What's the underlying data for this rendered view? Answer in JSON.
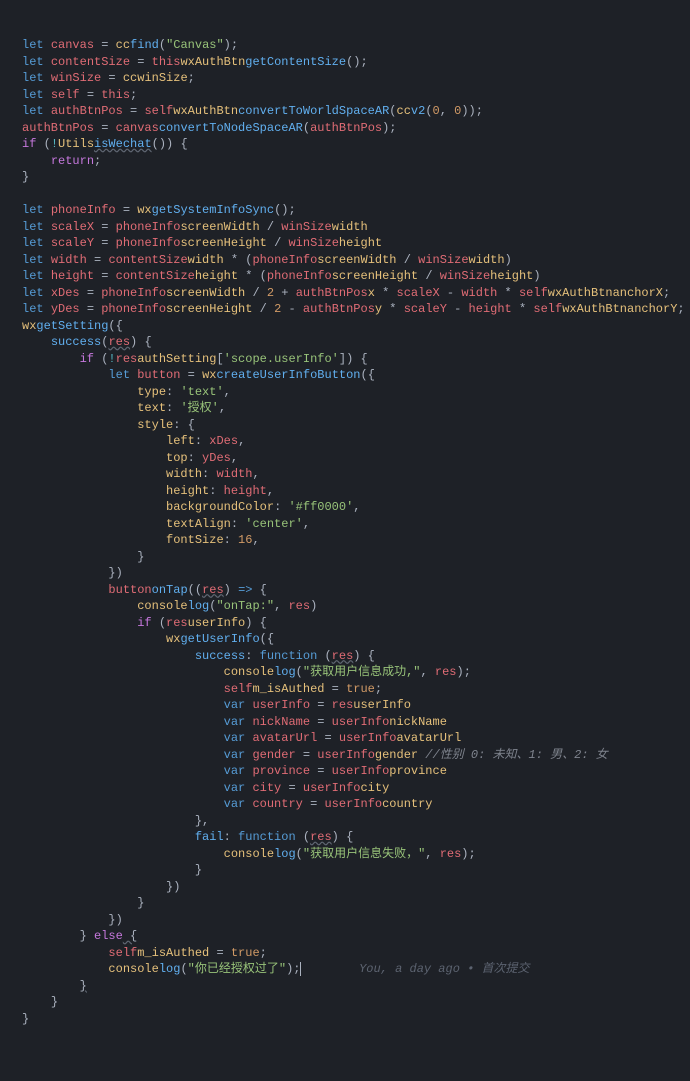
{
  "l1": {
    "let": "let",
    "canvas": "canvas",
    "eq": " = ",
    "cc": "cc",
    ".": ".",
    "find": "find",
    "p1": "(",
    "s": "\"Canvas\"",
    "p2": ");"
  },
  "l2": {
    "let": "let",
    "cs": "contentSize",
    "eq": " = ",
    "this": "this",
    ".": ".",
    "wx": "wxAuthBtn",
    ".2": ".",
    "gc": "getContentSize",
    "p": "();"
  },
  "l3": {
    "let": "let",
    "ws": "winSize",
    "eq": " = ",
    "cc": "cc",
    ".": ".",
    "wsz": "winSize",
    "sc": ";"
  },
  "l4": {
    "let": "let",
    "self": "self",
    "eq": " = ",
    "this": "this",
    "sc": ";"
  },
  "l5": {
    "let": "let",
    "abp": "authBtnPos",
    "eq": " = ",
    "self": "self",
    ".": ".",
    "wx": "wxAuthBtn",
    ".2": ".",
    "conv": "convertToWorldSpaceAR",
    "p1": "(",
    "cc": "cc",
    ".3": ".",
    "v2": "v2",
    "p2": "(",
    "z1": "0",
    "c": ", ",
    "z2": "0",
    "p3": "));"
  },
  "l6": {
    "abp": "authBtnPos",
    "eq": " = ",
    "canvas": "canvas",
    ".": ".",
    "conv": "convertToNodeSpaceAR",
    "p1": "(",
    "abp2": "authBtnPos",
    "p2": ");"
  },
  "l7": {
    "if": "if",
    "p1": " (",
    "neg": "!",
    "U": "Utils",
    ".": ".",
    "iw": "isWechat",
    "p2": "()) {"
  },
  "l8": {
    "ret": "return",
    "sc": ";"
  },
  "l9": {
    "b": "}"
  },
  "l11": {
    "let": "let",
    "pi": "phoneInfo",
    "eq": " = ",
    "wx": "wx",
    ".": ".",
    "gs": "getSystemInfoSync",
    "p": "();"
  },
  "l12": {
    "let": "let",
    "sx": "scaleX",
    "eq": " = ",
    "pi": "phoneInfo",
    ".": ".",
    "sw": "screenWidth",
    "d": " / ",
    "ws": "winSize",
    ".2": ".",
    "w": "width"
  },
  "l13": {
    "let": "let",
    "sy": "scaleY",
    "eq": " = ",
    "pi": "phoneInfo",
    ".": ".",
    "sh": "screenHeight",
    "d": " / ",
    "ws": "winSize",
    ".2": ".",
    "h": "height"
  },
  "l14": {
    "let": "let",
    "w": "width",
    "eq": " = ",
    "cs": "contentSize",
    ".": ".",
    "w2": "width",
    "m": " * (",
    "pi": "phoneInfo",
    ".2": ".",
    "sw": "screenWidth",
    "d": " / ",
    "ws": "winSize",
    ".3": ".",
    "w3": "width",
    "p": ")"
  },
  "l15": {
    "let": "let",
    "h": "height",
    "eq": " = ",
    "cs": "contentSize",
    ".": ".",
    "h2": "height",
    "m": " * (",
    "pi": "phoneInfo",
    ".2": ".",
    "sh": "screenHeight",
    "d": " / ",
    "ws": "winSize",
    ".3": ".",
    "h3": "height",
    "p": ")"
  },
  "l16": {
    "let": "let",
    "xd": "xDes",
    "eq": " = ",
    "pi": "phoneInfo",
    ".": ".",
    "sw": "screenWidth",
    "d": " / ",
    "n2": "2",
    "pl": " + ",
    "abp": "authBtnPos",
    ".2": ".",
    "x": "x",
    "m": " * ",
    "sx": "scaleX",
    "mn": " - ",
    "w": "width",
    "m2": " * ",
    "self": "self",
    ".3": ".",
    "wx": "wxAuthBtn",
    ".4": ".",
    "ax": "anchorX",
    "sc": ";"
  },
  "l17": {
    "let": "let",
    "yd": "yDes",
    "eq": " = ",
    "pi": "phoneInfo",
    ".": ".",
    "sh": "screenHeight",
    "d": " / ",
    "n2": "2",
    "mn": " - ",
    "abp": "authBtnPos",
    ".2": ".",
    "y": "y",
    "m": " * ",
    "sy": "scaleY",
    "mn2": " - ",
    "h": "height",
    "m2": " * ",
    "self": "self",
    ".3": ".",
    "wx": "wxAuthBtn",
    ".4": ".",
    "ay": "anchorY",
    "sc": ";"
  },
  "l18": {
    "wx": "wx",
    ".": ".",
    "gs": "getSetting",
    "p": "({"
  },
  "l19": {
    "suc": "success",
    "p1": "(",
    "res": "res",
    "p2": ") {"
  },
  "l20": {
    "if": "if",
    "p1": " (",
    "neg": "!",
    "res": "res",
    ".": ".",
    "as": "authSetting",
    "b1": "[",
    "s": "'scope.userInfo'",
    "b2": "]) {"
  },
  "l21": {
    "let": "let",
    "btn": "button",
    "eq": " = ",
    "wx": "wx",
    ".": ".",
    "cui": "createUserInfoButton",
    "p": "({"
  },
  "l22": {
    "type": "type",
    "c": ": ",
    "s": "'text'",
    "cm": ","
  },
  "l23": {
    "text": "text",
    "c": ": ",
    "s": "'授权'",
    "cm": ","
  },
  "l24": {
    "style": "style",
    "c": ": {"
  },
  "l25": {
    "left": "left",
    "c": ": ",
    "xd": "xDes",
    "cm": ","
  },
  "l26": {
    "top": "top",
    "c": ": ",
    "yd": "yDes",
    "cm": ","
  },
  "l27": {
    "width": "width",
    "c": ": ",
    "w": "width",
    "cm": ","
  },
  "l28": {
    "height": "height",
    "c": ": ",
    "h": "height",
    "cm": ","
  },
  "l29": {
    "bg": "backgroundColor",
    "c": ": ",
    "s": "'#ff0000'",
    "cm": ","
  },
  "l30": {
    "ta": "textAlign",
    "c": ": ",
    "s": "'center'",
    "cm": ","
  },
  "l31": {
    "fs": "fontSize",
    "c": ": ",
    "n": "16",
    "cm": ","
  },
  "l32": {
    "b": "}"
  },
  "l33": {
    "b": "})"
  },
  "l34": {
    "btn": "button",
    ".": ".",
    "ot": "onTap",
    "p1": "((",
    "res": "res",
    "p2": ") ",
    "ar": "=>",
    "b": " {"
  },
  "l35": {
    "con": "console",
    ".": ".",
    "log": "log",
    "p1": "(",
    "s": "\"onTap:\"",
    "c": ", ",
    "res": "res",
    "p2": ")"
  },
  "l36": {
    "if": "if",
    "p1": " (",
    "res": "res",
    ".": ".",
    "ui": "userInfo",
    "p2": ") {"
  },
  "l37": {
    "wx": "wx",
    ".": ".",
    "gui": "getUserInfo",
    "p": "({"
  },
  "l38": {
    "suc": "success",
    "c": ": ",
    "fn": "function",
    "p1": " (",
    "res": "res",
    "p2": ") {"
  },
  "l39": {
    "con": "console",
    ".": ".",
    "log": "log",
    "p1": "(",
    "s": "\"获取用户信息成功,\"",
    "c": ", ",
    "res": "res",
    "p2": ");"
  },
  "l40": {
    "self": "self",
    ".": ".",
    "ia": "m_isAuthed",
    "eq": " = ",
    "tr": "true",
    "sc": ";"
  },
  "l41": {
    "var": "var",
    "ui": "userInfo",
    "eq": " = ",
    "res": "res",
    ".": ".",
    "ui2": "userInfo"
  },
  "l42": {
    "var": "var",
    "nn": "nickName",
    "eq": " = ",
    "ui": "userInfo",
    ".": ".",
    "nn2": "nickName"
  },
  "l43": {
    "var": "var",
    "au": "avatarUrl",
    "eq": " = ",
    "ui": "userInfo",
    ".": ".",
    "au2": "avatarUrl"
  },
  "l44": {
    "var": "var",
    "g": "gender",
    "eq": " = ",
    "ui": "userInfo",
    ".": ".",
    "g2": "gender",
    "cm": " //性别 0: 未知、1: 男、2: 女"
  },
  "l45": {
    "var": "var",
    "p": "province",
    "eq": " = ",
    "ui": "userInfo",
    ".": ".",
    "p2": "province"
  },
  "l46": {
    "var": "var",
    "c": "city",
    "eq": " = ",
    "ui": "userInfo",
    ".": ".",
    "c2": "city"
  },
  "l47": {
    "var": "var",
    "co": "country",
    "eq": " = ",
    "ui": "userInfo",
    ".": ".",
    "co2": "country"
  },
  "l48": {
    "b": "},"
  },
  "l49": {
    "fail": "fail",
    "c": ": ",
    "fn": "function",
    "p1": " (",
    "res": "res",
    "p2": ") {"
  },
  "l50": {
    "con": "console",
    ".": ".",
    "log": "log",
    "p1": "(",
    "s": "\"获取用户信息失败，\"",
    "c": ", ",
    "res": "res",
    "p2": ");"
  },
  "l51": {
    "b": "}"
  },
  "l52": {
    "b": "})"
  },
  "l53": {
    "b": "}"
  },
  "l54": {
    "b": "})"
  },
  "l55": {
    "b1": "} ",
    "else": "else",
    "b2": " {"
  },
  "l56": {
    "self": "self",
    ".": ".",
    "ia": "m_isAuthed",
    "eq": " = ",
    "tr": "true",
    "sc": ";"
  },
  "l57": {
    "con": "console",
    ".": ".",
    "log": "log",
    "p1": "(",
    "s": "\"你已经授权过了\"",
    "p2": ");",
    "annot": "You, a day ago • 首次提交"
  },
  "l58": {
    "b": "}"
  },
  "l59": {
    "b": "}"
  },
  "l60": {
    "b": "}"
  }
}
